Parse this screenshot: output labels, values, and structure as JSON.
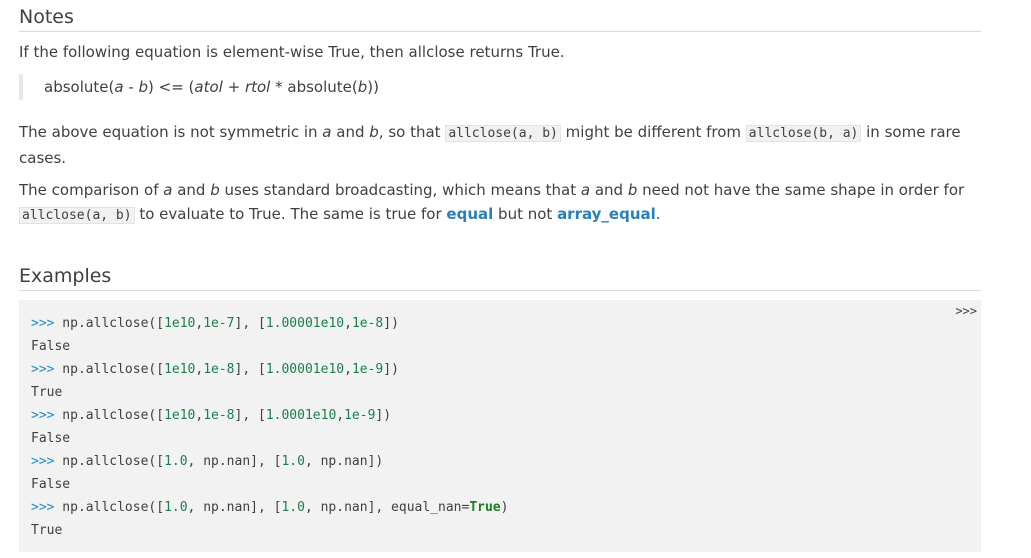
{
  "notes": {
    "heading": "Notes",
    "intro": "If the following equation is element-wise True, then allclose returns True.",
    "equation": {
      "p1": "absolute(",
      "a": "a",
      "p2": " - ",
      "b": "b",
      "p3": ") <= (",
      "atol": "atol",
      "p4": " + ",
      "rtol": "rtol",
      "p5": " * absolute(",
      "b2": "b",
      "p6": "))"
    },
    "para2": {
      "t1": "The above equation is not symmetric in ",
      "a": "a",
      "t2": " and ",
      "b": "b",
      "t3": ", so that ",
      "code1": "allclose(a, b)",
      "t4": " might be different from ",
      "code2": "allclose(b, a)",
      "t5": " in some rare cases."
    },
    "para3": {
      "t1": "The comparison of ",
      "a": "a",
      "t2": " and ",
      "b": "b",
      "t3": " uses standard broadcasting, which means that ",
      "a2": "a",
      "t4": " and ",
      "b2": "b",
      "t5": " need not have the same shape in order for ",
      "code1": "allclose(a, b)",
      "t6": " to evaluate to True. The same is true for ",
      "link1": "equal",
      "t7": " but not ",
      "link2": "array_equal",
      "t8": "."
    }
  },
  "examples": {
    "heading": "Examples",
    "copy_label": ">>>",
    "lines": [
      {
        "prompt": ">>>",
        "pre": " np.allclose([",
        "n1": "1e10",
        "c1": ",",
        "n2": "1e-7",
        "mid": "], [",
        "n3": "1.00001e10",
        "c2": ",",
        "n4": "1e-8",
        "post": "])"
      },
      {
        "output": "False"
      },
      {
        "prompt": ">>>",
        "pre": " np.allclose([",
        "n1": "1e10",
        "c1": ",",
        "n2": "1e-8",
        "mid": "], [",
        "n3": "1.00001e10",
        "c2": ",",
        "n4": "1e-9",
        "post": "])"
      },
      {
        "output": "True"
      },
      {
        "prompt": ">>>",
        "pre": " np.allclose([",
        "n1": "1e10",
        "c1": ",",
        "n2": "1e-8",
        "mid": "], [",
        "n3": "1.0001e10",
        "c2": ",",
        "n4": "1e-9",
        "post": "])"
      },
      {
        "output": "False"
      },
      {
        "prompt": ">>>",
        "pre": " np.allclose([",
        "n1": "1.0",
        "c1": ", np.nan], [",
        "n2": "1.0",
        "mid": ", np.nan])",
        "n3": "",
        "c2": "",
        "n4": "",
        "post": ""
      },
      {
        "output": "False"
      },
      {
        "prompt": ">>>",
        "pre": " np.allclose([",
        "n1": "1.0",
        "c1": ", np.nan], [",
        "n2": "1.0",
        "mid": ", np.nan], equal_nan=",
        "kw": "True",
        "post": ")"
      },
      {
        "output": "True"
      }
    ]
  }
}
